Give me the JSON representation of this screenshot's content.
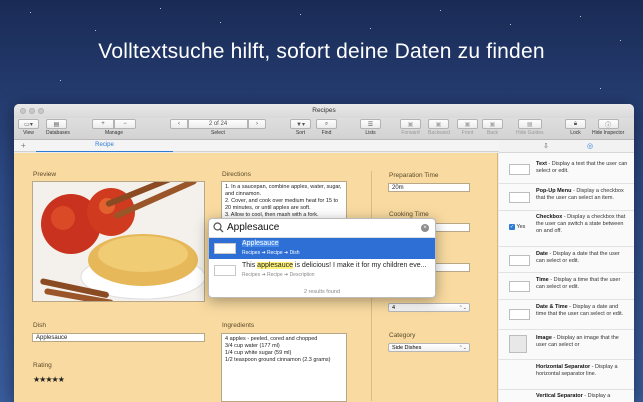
{
  "headline": "Volltextsuche hilft, sofort deine Daten zu finden",
  "window": {
    "title": "Recipes"
  },
  "toolbar": {
    "view": "View",
    "databases": "Databases",
    "manage": "Manage",
    "select": "Select",
    "record_counter": "2 of 24",
    "sort": "Sort",
    "find": "Find",
    "lists": "Lists",
    "forward": "Forward",
    "backward": "Backward",
    "front": "Front",
    "back": "Back",
    "hide_guides": "Hide Guides",
    "lock": "Lock",
    "hide_inspector": "Hide Inspector"
  },
  "tabs": {
    "add": "+",
    "active": "Recipe"
  },
  "form": {
    "preview_label": "Preview",
    "directions_label": "Directions",
    "directions_text": "1. In a saucepan, combine apples, water, sugar, and cinnamon.\n2. Cover, and cook over medium heat for 15 to 20 minutes, or until apples are soft.\n3. Allow to cool, then mash with a fork.",
    "prep_time_label": "Preparation Time",
    "prep_time_value": "20m",
    "cooking_time_label": "Cooking Time",
    "servings_value": "4",
    "category_label": "Category",
    "category_value": "Side Dishes",
    "dish_label": "Dish",
    "dish_value": "Applesauce",
    "ingredients_label": "Ingredients",
    "ingredients_text": "4 apples - peeled, cored and chopped\n3/4 cup water (177 ml)\n1/4 cup white sugar (59 ml)\n1/2 teaspoon ground cinnamon (2.3 grams)",
    "rating_label": "Rating",
    "rating_value": 5,
    "rating_stars": "★★★★★"
  },
  "search": {
    "query": "Applesauce",
    "results": [
      {
        "title": "Applesauce",
        "path": "Recipes ➔ Recipe ➔ Dish"
      },
      {
        "title_pre": "This ",
        "title_hl": "applesauce",
        "title_post": " is delicious! I make it for my children eve...",
        "path": "Recipes ➔ Recipe ➔ Description"
      }
    ],
    "found_text": "2 results found"
  },
  "inspector": {
    "items": [
      {
        "name": "Text",
        "desc": " - Display a text that the user can select or edit."
      },
      {
        "name": "Pop-Up Menu",
        "desc": " - Display a checkbox that the user can select an item."
      },
      {
        "name": "Checkbox",
        "desc": " - Display a checkbox that the user can switch a state between on and off.",
        "thumb_text": "Yes"
      },
      {
        "name": "Date",
        "desc": " - Display a date that the user can select or edit."
      },
      {
        "name": "Time",
        "desc": " - Display a time that the user can select or edit."
      },
      {
        "name": "Date & Time",
        "desc": " - Display a date and time that the user can select or edit."
      },
      {
        "name": "Image",
        "desc": " - Display an image that the user can select or"
      },
      {
        "name": "Horizontal Separator",
        "desc": " - Display a horizontal separator line."
      },
      {
        "name": "Vertical Separator",
        "desc": " - Display a"
      }
    ]
  },
  "colors": {
    "form_bg": "#f9dba1",
    "accent": "#2e7bd6",
    "selection": "#2e6fd6",
    "highlight": "#fff37a"
  }
}
